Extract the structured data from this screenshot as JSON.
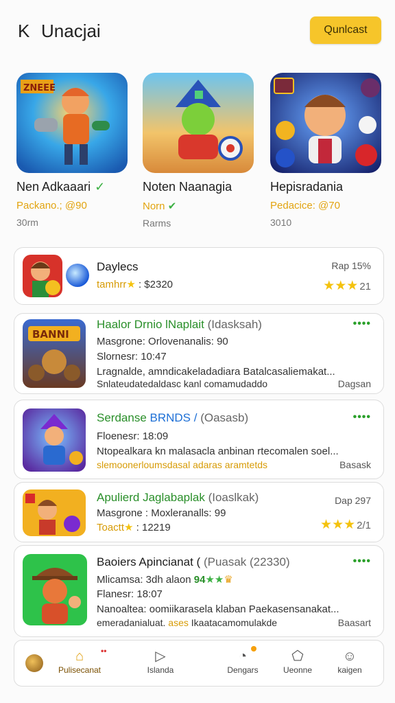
{
  "header": {
    "back": "K",
    "title": "Unacjai",
    "cta": "Qunlcast"
  },
  "featured": [
    {
      "name": "Nen Adkaaari",
      "meta": "Packano.; @90",
      "sub": "30rm",
      "check": "✓",
      "banner": "ZNEEE"
    },
    {
      "name": "Noten Naanagia",
      "meta": "Norn",
      "sub": "Rarms",
      "check": ""
    },
    {
      "name": "Hepisradania",
      "meta": "Pedacice: @70",
      "sub": "3010",
      "check": ""
    }
  ],
  "cards": [
    {
      "title": "Daylecs",
      "line1_label": "tamhrr",
      "line1_value": ": $2320",
      "right_top": "Rap  15%",
      "rating_num": "21"
    },
    {
      "title": "Haalor Drnio lNaplait",
      "title_suffix": "(Idasksah)",
      "line1": "Masgrone: Orlovenanalis: 90",
      "line2": "Slornesr: 10:47",
      "line3": "Lragnalde, amndicakeladadiara Batalcasaliemakat...",
      "line4": "Snlateudatedaldasc kanl comamudaddo",
      "right_bottom": "Dagsan"
    },
    {
      "title": "Serdanse",
      "title_blue": "BRNDS /",
      "title_suffix": "(Oasasb)",
      "line1": "Floenesr: 18:09",
      "line2": "Ntopealkara kn malasacla anbinan rtecomalen soel...",
      "line3": "slemoonerloumsdasal adaras aramtetds",
      "right_bottom": "Basask"
    },
    {
      "title": "Apulierd Jaglabaplak",
      "title_suffix": "(Ioaslkak)",
      "line1": "Masgrone : Moxleranalls: 99",
      "line2_label": "Toactt",
      "line2_value": ": 12219",
      "right_top": "Dap  297",
      "rating_num": "2/1"
    },
    {
      "title": "Baoiers Apincianat (",
      "title_suffix": "(Puasak (22330)",
      "line1": "Mlicamsa: 3dh alaon",
      "line1_green": "94",
      "line2": "Flanesr: 18:07",
      "line3": "Nanoaltea: oomiikarasela klaban Paekasensanakat...",
      "line4": "emeradanialuat.",
      "line4_yellow": "ases",
      "line4_rest": "Ikaatacamomulakde",
      "right_bottom": "Baasart"
    }
  ],
  "nav": [
    {
      "label": "Pulisecanat",
      "icon": "home-icon"
    },
    {
      "label": "Islanda",
      "icon": "play-icon"
    },
    {
      "label": "Dengars",
      "icon": "speedometer-icon"
    },
    {
      "label": "Ueonne",
      "icon": "pentagon-icon"
    },
    {
      "label": "kaigen",
      "icon": "smiley-icon"
    }
  ],
  "colors": {
    "accent": "#f6c52a",
    "green": "#2a8f2a",
    "star": "#f4c20d"
  }
}
